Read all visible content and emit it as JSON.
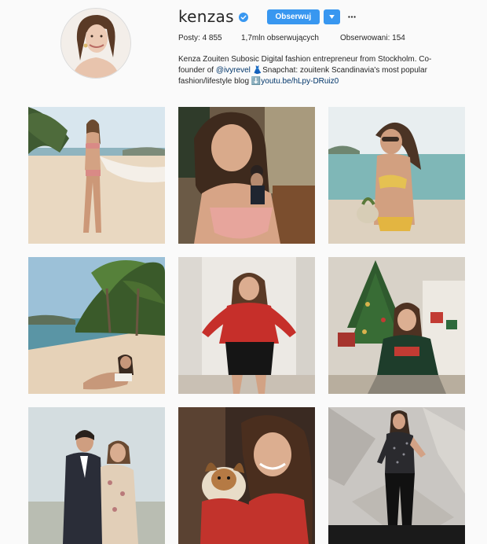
{
  "profile": {
    "username": "kenzas",
    "verified": true,
    "follow_label": "Obserwuj",
    "stats": {
      "posts_label": "Posty:",
      "posts_value": "4 855",
      "followers_value": "1,7mln",
      "followers_label": "obserwujących",
      "following_label": "Obserwowani:",
      "following_value": "154"
    },
    "bio": {
      "text1": "Kenza Zouiten Subosic Digital fashion entrepreneur from Stockholm. Co-founder of ",
      "mention": "@ivyrevel",
      "text2": " 👗Snapchat: zouitenk Scandinavia's most popular fashion/lifestyle blog ",
      "link": "⬇️youtu.be/hLpy-DRuiz0"
    }
  },
  "posts": [
    {
      "id": 1,
      "scene": "beach woman in pink bikini"
    },
    {
      "id": 2,
      "scene": "selfie in pink swimsuit with man"
    },
    {
      "id": 3,
      "scene": "beach woman in yellow bikini with coconut"
    },
    {
      "id": 4,
      "scene": "palm beach with woman lying on sand"
    },
    {
      "id": 5,
      "scene": "woman in red blouse and black skirt"
    },
    {
      "id": 6,
      "scene": "christmas tree and woman in sweater"
    },
    {
      "id": 7,
      "scene": "couple embracing outdoors"
    },
    {
      "id": 8,
      "scene": "woman holding small dog"
    },
    {
      "id": 9,
      "scene": "woman in black sequin dress on marble"
    }
  ],
  "colors": {
    "accent": "#3897f0",
    "link": "#003569",
    "background": "#fafafa"
  }
}
